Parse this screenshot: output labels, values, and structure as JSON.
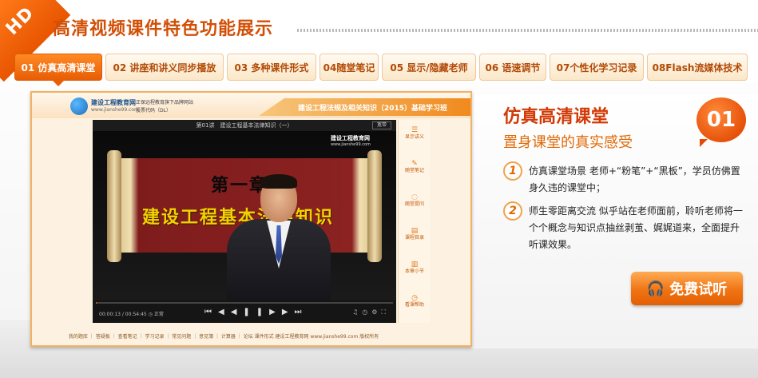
{
  "header": {
    "corner_badge": "HD",
    "title": "高清视频课件特色功能展示"
  },
  "tabs": [
    {
      "label": "01 仿真高清课堂",
      "active": true
    },
    {
      "label": "02 讲座和讲义同步播放",
      "active": false
    },
    {
      "label": "03 多种课件形式",
      "active": false
    },
    {
      "label": "04随堂笔记",
      "active": false
    },
    {
      "label": "05 显示/隐藏老师",
      "active": false
    },
    {
      "label": "06 语速调节",
      "active": false
    },
    {
      "label": "07个性化学习记录",
      "active": false
    },
    {
      "label": "08Flash流媒体技术",
      "active": false
    }
  ],
  "screenshot": {
    "logo_name": "建设工程教育网",
    "logo_url": "www.jianshe99.com",
    "slogan": "正保远程教育旗下品牌网站",
    "stock_code": "股票代码（DL）",
    "course_title": "建设工程法规及相关知识（2015）基础学习班",
    "video_title": "第01讲　建设工程基本法律知识（一）",
    "wide_button": "宽带",
    "watermark_name": "建设工程教育网",
    "watermark_url": "www.jianshe99.com",
    "board_line1": "第一章",
    "board_line2": "建设工程基本法律知识",
    "time": "00:00:13 / 00:54:45",
    "speed": "正常",
    "progress_fraction": 0.004,
    "controls": "⏮◀◀❚❚▶▶⏭",
    "right_controls": "♫◷⚙⛶",
    "side_items": [
      {
        "icon": "☰",
        "label": "显示讲义"
      },
      {
        "icon": "✎",
        "label": "随堂笔记"
      },
      {
        "icon": "◌",
        "label": "随堂提问"
      },
      {
        "icon": "▤",
        "label": "课程目录"
      },
      {
        "icon": "▥",
        "label": "本章小节"
      },
      {
        "icon": "◷",
        "label": "看课帮助"
      }
    ],
    "footer": "我的题库 ｜ 答疑板 ｜ 查看笔记 ｜ 学习记录 ｜ 常见问题 ｜ 意见簿 ｜ 计算器 ｜ 论坛  课件形式   建设工程教育网 www.jianshe99.com 版权所有"
  },
  "feature": {
    "title": "仿真高清课堂",
    "number": "01",
    "subtitle": "置身课堂的真实感受",
    "points": [
      {
        "num": "1",
        "text": "仿真课堂场景 老师+“粉笔”+“黑板”，学员仿佛置身久违的课堂中；"
      },
      {
        "num": "2",
        "text": "师生零距离交流 似乎站在老师面前，聆听老师将一个个概念与知识点抽丝剥茧、娓娓道来，全面提升听课效果。"
      }
    ],
    "trial_button": "免费试听",
    "trial_icon": "headphones-icon"
  },
  "colors": {
    "accent": "#e85d05",
    "title_red": "#d23a06",
    "tab_text": "#b24a06"
  }
}
